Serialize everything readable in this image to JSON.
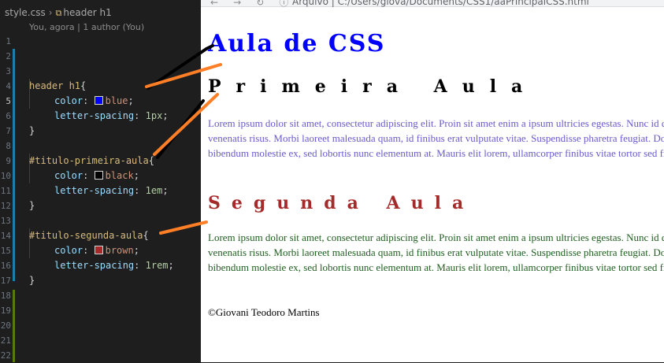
{
  "editor": {
    "filename": "style.css",
    "breadcrumb_symbol": "header h1",
    "blame": "You, agora | 1 author (You)",
    "lines": [
      {
        "n": "1"
      },
      {
        "n": "2"
      },
      {
        "n": "3"
      },
      {
        "n": "4"
      },
      {
        "n": "5"
      },
      {
        "n": "6"
      },
      {
        "n": "7"
      },
      {
        "n": "8"
      },
      {
        "n": "9"
      },
      {
        "n": "10"
      },
      {
        "n": "11"
      },
      {
        "n": "12"
      },
      {
        "n": "13"
      },
      {
        "n": "14"
      },
      {
        "n": "15"
      },
      {
        "n": "16"
      },
      {
        "n": "17"
      },
      {
        "n": "18"
      },
      {
        "n": "19"
      },
      {
        "n": "20"
      },
      {
        "n": "21"
      },
      {
        "n": "22"
      }
    ],
    "code": {
      "r1_selector": "header h1",
      "r1_open": "{",
      "r1_p1": "color",
      "r1_v1": "blue",
      "r1_p2": "letter-spacing",
      "r1_v2": "1px",
      "r1_close": "}",
      "r2_selector": "#titulo-primeira-aula",
      "r2_open": "{",
      "r2_p1": "color",
      "r2_v1": "black",
      "r2_p2": "letter-spacing",
      "r2_v2": "1em",
      "r2_close": "}",
      "r3_selector": "#titulo-segunda-aula",
      "r3_open": "{",
      "r3_p1": "color",
      "r3_v1": "brown",
      "r3_p2": "letter-spacing",
      "r3_v2": "1rem",
      "r3_close": "}",
      "colon": ":",
      "semi": ";"
    },
    "swatches": {
      "blue": "#0000ff",
      "black": "#000000",
      "brown": "#a52a2a"
    }
  },
  "browser": {
    "url": "Arquivo  |  C:/Users/giova/Documents/CSS1/aaPrincipalCSS.html",
    "h1": "Aula de CSS",
    "h2_first": "Primeira Aula",
    "h2_second": "Segunda Aula",
    "lorem": "Lorem ipsum dolor sit amet, consectetur adipiscing elit. Proin sit amet enim a ipsum ultricies egestas. Nunc id dui nec, venenatis risus. Morbi laoreet malesuada quam, id finibus erat vulputate vitae. Suspendisse pharetra feugiat. Donec bibendum molestie ex, sed lobortis nunc elementum at. Mauris elit lorem, ullamcorper finibus vitae tortor sed fringilla.",
    "footer": "©Giovani Teodoro Martins"
  }
}
